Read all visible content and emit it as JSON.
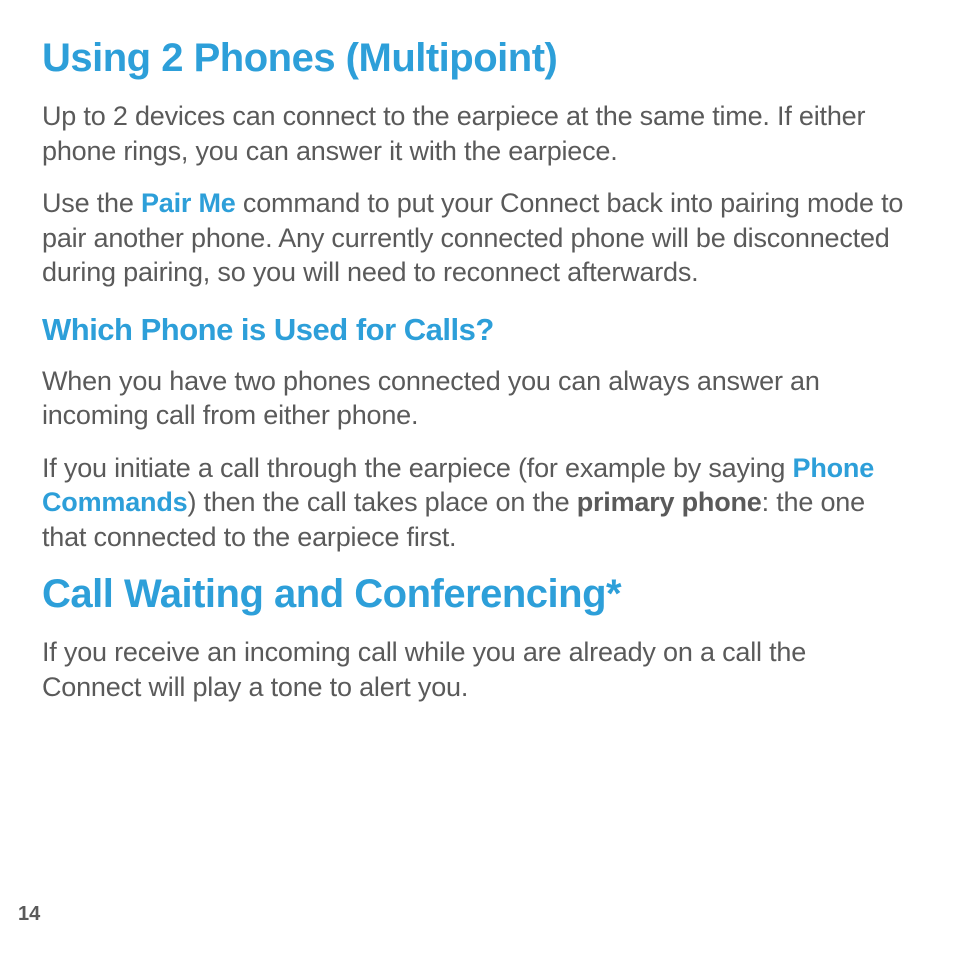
{
  "section1": {
    "heading": "Using 2 Phones (Multipoint)",
    "p1": "Up to 2 devices can connect to the earpiece at the same time. If either phone rings, you can answer it with the earpiece.",
    "p2_a": "Use the ",
    "p2_cmd": "Pair Me",
    "p2_b": " command to put your Connect back into pairing mode to pair another phone. Any currently connected phone will be disconnected during pairing, so you will need to reconnect afterwards.",
    "sub1": {
      "heading": "Which Phone is Used for Calls?",
      "p1": "When you have two phones connected you can always answer an incoming call from either phone.",
      "p2_a": "If you initiate a call through the earpiece (for example by saying ",
      "p2_cmd": "Phone Commands",
      "p2_b": ") then the call takes place on the ",
      "p2_bold": "primary phone",
      "p2_c": ": the one that connected to the earpiece first."
    }
  },
  "section2": {
    "heading": "Call Waiting and Conferencing*",
    "p1": "If you receive an incoming call while you are already on a call the Connect will play a tone to alert you."
  },
  "page_number": "14"
}
